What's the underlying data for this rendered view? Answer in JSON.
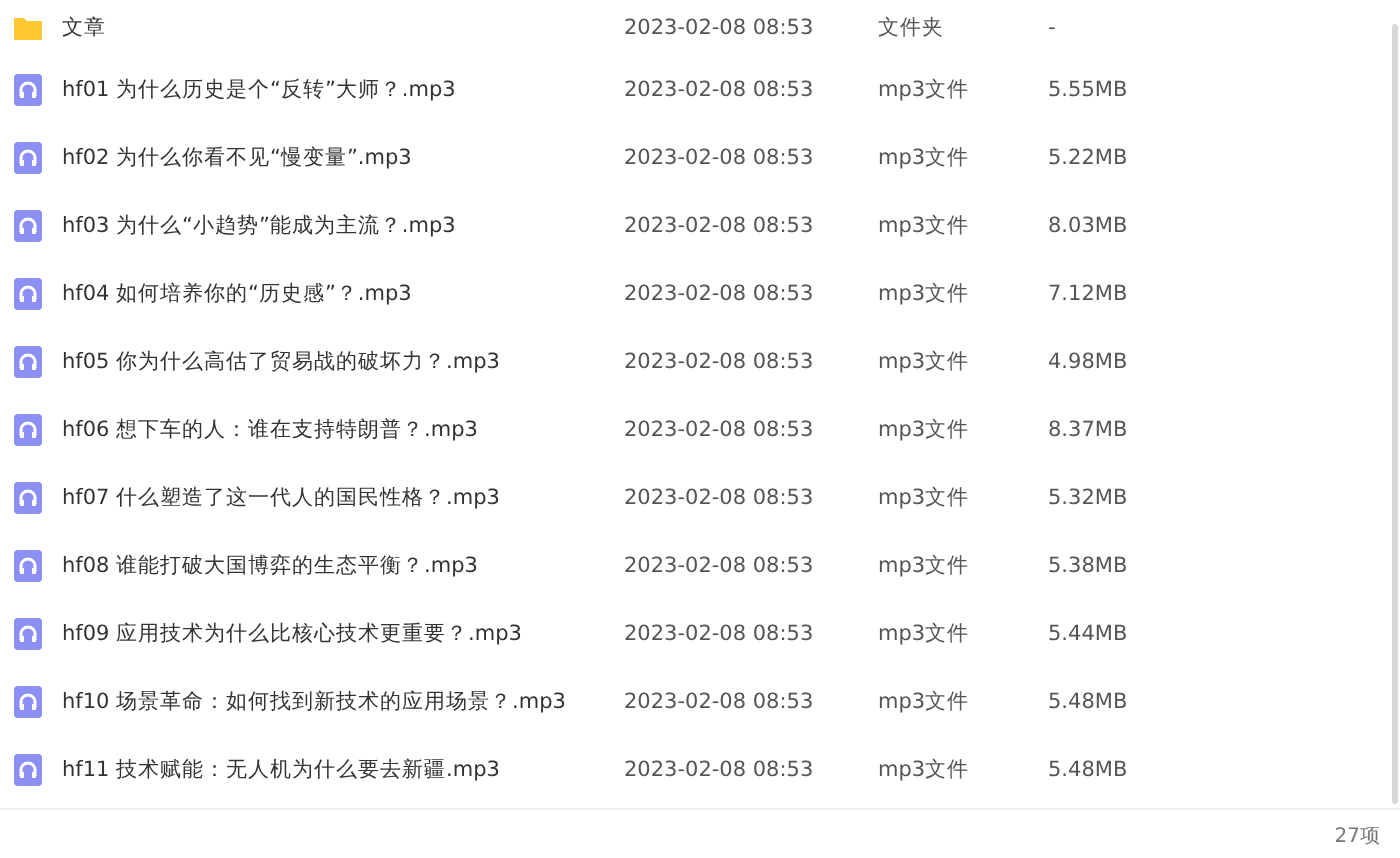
{
  "files": [
    {
      "kind": "folder",
      "name": "文章",
      "modified": "2023-02-08 08:53",
      "type": "文件夹",
      "size": "-"
    },
    {
      "kind": "audio",
      "name": "hf01  为什么历史是个“反转”大师？.mp3",
      "modified": "2023-02-08 08:53",
      "type": "mp3文件",
      "size": "5.55MB"
    },
    {
      "kind": "audio",
      "name": "hf02  为什么你看不见“慢变量”.mp3",
      "modified": "2023-02-08 08:53",
      "type": "mp3文件",
      "size": "5.22MB"
    },
    {
      "kind": "audio",
      "name": "hf03  为什么“小趋势”能成为主流？.mp3",
      "modified": "2023-02-08 08:53",
      "type": "mp3文件",
      "size": "8.03MB"
    },
    {
      "kind": "audio",
      "name": "hf04  如何培养你的“历史感”？.mp3",
      "modified": "2023-02-08 08:53",
      "type": "mp3文件",
      "size": "7.12MB"
    },
    {
      "kind": "audio",
      "name": "hf05  你为什么高估了贸易战的破坏力？.mp3",
      "modified": "2023-02-08 08:53",
      "type": "mp3文件",
      "size": "4.98MB"
    },
    {
      "kind": "audio",
      "name": "hf06  想下车的人：谁在支持特朗普？.mp3",
      "modified": "2023-02-08 08:53",
      "type": "mp3文件",
      "size": "8.37MB"
    },
    {
      "kind": "audio",
      "name": "hf07  什么塑造了这一代人的国民性格？.mp3",
      "modified": "2023-02-08 08:53",
      "type": "mp3文件",
      "size": "5.32MB"
    },
    {
      "kind": "audio",
      "name": "hf08  谁能打破大国博弈的生态平衡？.mp3",
      "modified": "2023-02-08 08:53",
      "type": "mp3文件",
      "size": "5.38MB"
    },
    {
      "kind": "audio",
      "name": "hf09  应用技术为什么比核心技术更重要？.mp3",
      "modified": "2023-02-08 08:53",
      "type": "mp3文件",
      "size": "5.44MB"
    },
    {
      "kind": "audio",
      "name": "hf10  场景革命：如何找到新技术的应用场景？.mp3",
      "modified": "2023-02-08 08:53",
      "type": "mp3文件",
      "size": "5.48MB"
    },
    {
      "kind": "audio",
      "name": "hf11  技术赋能：无人机为什么要去新疆.mp3",
      "modified": "2023-02-08 08:53",
      "type": "mp3文件",
      "size": "5.48MB"
    }
  ],
  "status_bar": {
    "count": "27项"
  }
}
